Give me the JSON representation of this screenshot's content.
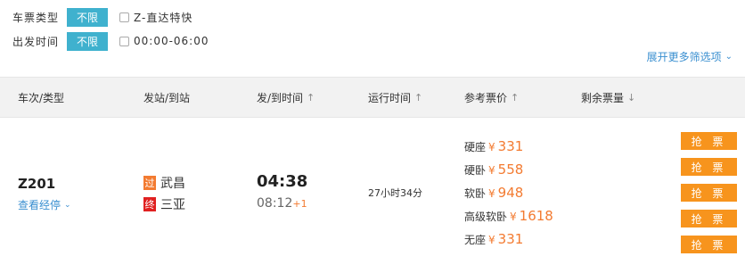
{
  "filters": {
    "ticket_type": {
      "label": "车票类型",
      "button": "不限",
      "option": "Z-直达特快"
    },
    "depart_time": {
      "label": "出发时间",
      "button": "不限",
      "option": "00:00-06:00"
    }
  },
  "more_options": "展开更多筛选项",
  "table_header": {
    "train": "车次/类型",
    "stations": "发站/到站",
    "times": "发/到时间",
    "duration": "运行时间",
    "price": "参考票价",
    "remaining": "剩余票量",
    "sort_up": "↑",
    "sort_down": "↓"
  },
  "train": {
    "number": "Z201",
    "stops_link": "查看经停",
    "from_badge": "过",
    "from_station": "武昌",
    "to_badge": "终",
    "to_station": "三亚",
    "depart": "04:38",
    "arrive": "08:12",
    "arrive_days": "+1",
    "duration": "27小时34分",
    "currency": "¥",
    "seats": [
      {
        "name": "硬座",
        "price": "331",
        "button": "抢 票"
      },
      {
        "name": "硬卧",
        "price": "558",
        "button": "抢 票"
      },
      {
        "name": "软卧",
        "price": "948",
        "button": "抢 票"
      },
      {
        "name": "高级软卧",
        "price": "1618",
        "button": "抢 票"
      },
      {
        "name": "无座",
        "price": "331",
        "button": "抢 票"
      }
    ]
  },
  "colors": {
    "accent_blue": "#3fb1ce",
    "link_blue": "#3a8fd0",
    "price_orange": "#f37b31",
    "button_orange": "#f7941d",
    "end_red": "#e02020"
  }
}
